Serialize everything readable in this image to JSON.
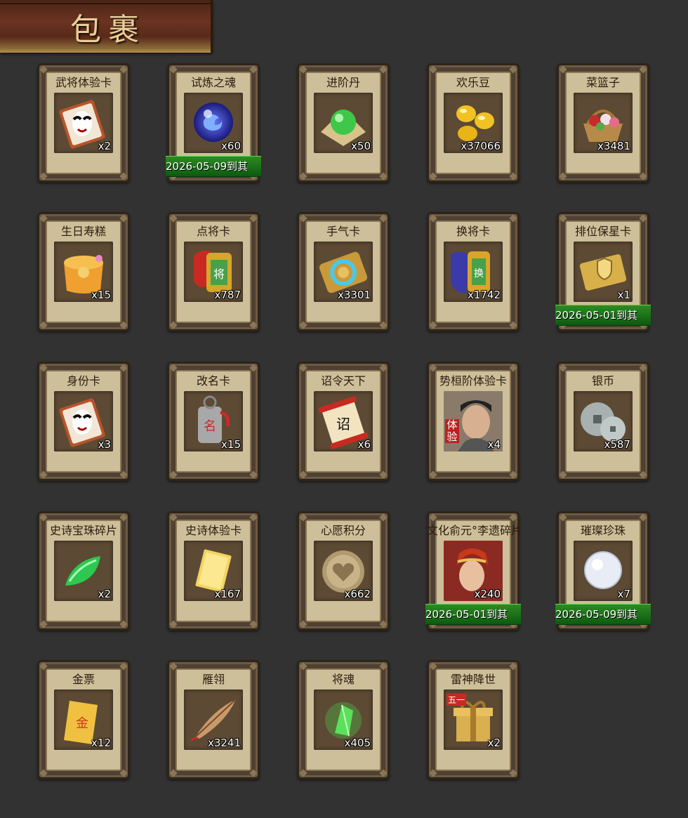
{
  "header": {
    "title": "包裹"
  },
  "items": [
    {
      "name": "武将体验卡",
      "count": "x2",
      "icon": "opera-mask-card-icon",
      "expiry": ""
    },
    {
      "name": "试炼之魂",
      "count": "x60",
      "icon": "dragon-orb-icon",
      "expiry": "2026-05-09到其"
    },
    {
      "name": "进阶丹",
      "count": "x50",
      "icon": "green-pill-icon",
      "expiry": ""
    },
    {
      "name": "欢乐豆",
      "count": "x37066",
      "icon": "gold-beans-icon",
      "expiry": ""
    },
    {
      "name": "菜篮子",
      "count": "x3481",
      "icon": "flower-basket-icon",
      "expiry": ""
    },
    {
      "name": "生日寿糕",
      "count": "x15",
      "icon": "birthday-cake-icon",
      "expiry": ""
    },
    {
      "name": "点将卡",
      "count": "x787",
      "icon": "general-token-icon",
      "expiry": ""
    },
    {
      "name": "手气卡",
      "count": "x3301",
      "icon": "luck-card-icon",
      "expiry": ""
    },
    {
      "name": "换将卡",
      "count": "x1742",
      "icon": "swap-general-icon",
      "expiry": ""
    },
    {
      "name": "排位保星卡",
      "count": "x1",
      "icon": "shield-ticket-icon",
      "expiry": "2026-05-01到其"
    },
    {
      "name": "身份卡",
      "count": "x3",
      "icon": "opera-mask-card-icon",
      "expiry": ""
    },
    {
      "name": "改名卡",
      "count": "x15",
      "icon": "rename-tag-icon",
      "expiry": ""
    },
    {
      "name": "诏令天下",
      "count": "x6",
      "icon": "edict-scroll-icon",
      "expiry": ""
    },
    {
      "name": "势桓阶体验卡",
      "count": "x4",
      "icon": "general-portrait-icon",
      "expiry": ""
    },
    {
      "name": "银币",
      "count": "x587",
      "icon": "silver-coin-icon",
      "expiry": ""
    },
    {
      "name": "史诗宝珠碎片",
      "count": "x2",
      "icon": "jade-shard-icon",
      "expiry": ""
    },
    {
      "name": "史诗体验卡",
      "count": "x167",
      "icon": "gold-card-icon",
      "expiry": ""
    },
    {
      "name": "心愿积分",
      "count": "x662",
      "icon": "heart-coin-icon",
      "expiry": ""
    },
    {
      "name": "文化俞元°李遗碎片",
      "count": "x240",
      "icon": "warrior-portrait-icon",
      "expiry": "2026-05-01到其"
    },
    {
      "name": "璀璨珍珠",
      "count": "x7",
      "icon": "pearl-icon",
      "expiry": "2026-05-09到其"
    },
    {
      "name": "金票",
      "count": "x12",
      "icon": "gold-scroll-icon",
      "expiry": ""
    },
    {
      "name": "雁翎",
      "count": "x3241",
      "icon": "feather-quill-icon",
      "expiry": ""
    },
    {
      "name": "将魂",
      "count": "x405",
      "icon": "green-crystal-icon",
      "expiry": ""
    },
    {
      "name": "雷神降世",
      "count": "x2",
      "icon": "gift-box-icon",
      "expiry": ""
    }
  ],
  "portrait_badge": "体验",
  "gift_badge": "五一"
}
